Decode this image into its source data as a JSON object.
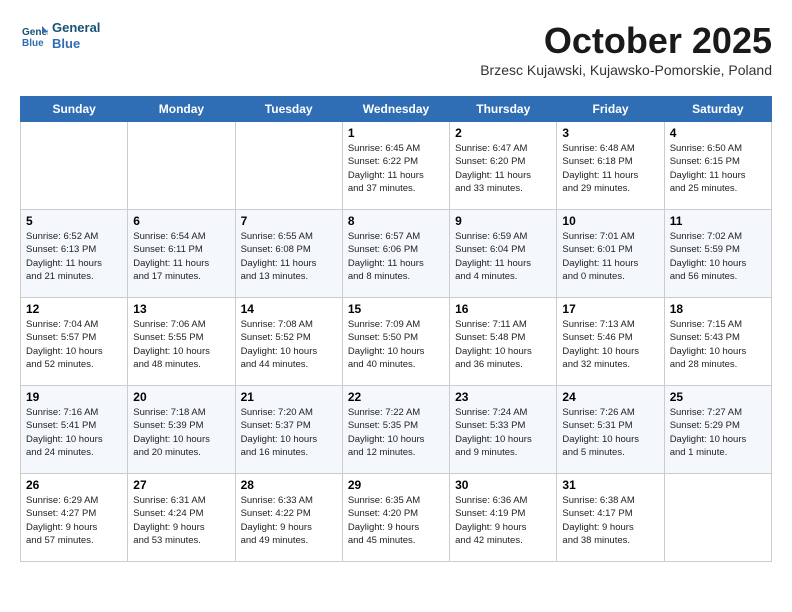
{
  "header": {
    "logo_line1": "General",
    "logo_line2": "Blue",
    "month_title": "October 2025",
    "subtitle": "Brzesc Kujawski, Kujawsko-Pomorskie, Poland"
  },
  "days_of_week": [
    "Sunday",
    "Monday",
    "Tuesday",
    "Wednesday",
    "Thursday",
    "Friday",
    "Saturday"
  ],
  "weeks": [
    [
      {
        "day": "",
        "info": ""
      },
      {
        "day": "",
        "info": ""
      },
      {
        "day": "",
        "info": ""
      },
      {
        "day": "1",
        "info": "Sunrise: 6:45 AM\nSunset: 6:22 PM\nDaylight: 11 hours\nand 37 minutes."
      },
      {
        "day": "2",
        "info": "Sunrise: 6:47 AM\nSunset: 6:20 PM\nDaylight: 11 hours\nand 33 minutes."
      },
      {
        "day": "3",
        "info": "Sunrise: 6:48 AM\nSunset: 6:18 PM\nDaylight: 11 hours\nand 29 minutes."
      },
      {
        "day": "4",
        "info": "Sunrise: 6:50 AM\nSunset: 6:15 PM\nDaylight: 11 hours\nand 25 minutes."
      }
    ],
    [
      {
        "day": "5",
        "info": "Sunrise: 6:52 AM\nSunset: 6:13 PM\nDaylight: 11 hours\nand 21 minutes."
      },
      {
        "day": "6",
        "info": "Sunrise: 6:54 AM\nSunset: 6:11 PM\nDaylight: 11 hours\nand 17 minutes."
      },
      {
        "day": "7",
        "info": "Sunrise: 6:55 AM\nSunset: 6:08 PM\nDaylight: 11 hours\nand 13 minutes."
      },
      {
        "day": "8",
        "info": "Sunrise: 6:57 AM\nSunset: 6:06 PM\nDaylight: 11 hours\nand 8 minutes."
      },
      {
        "day": "9",
        "info": "Sunrise: 6:59 AM\nSunset: 6:04 PM\nDaylight: 11 hours\nand 4 minutes."
      },
      {
        "day": "10",
        "info": "Sunrise: 7:01 AM\nSunset: 6:01 PM\nDaylight: 11 hours\nand 0 minutes."
      },
      {
        "day": "11",
        "info": "Sunrise: 7:02 AM\nSunset: 5:59 PM\nDaylight: 10 hours\nand 56 minutes."
      }
    ],
    [
      {
        "day": "12",
        "info": "Sunrise: 7:04 AM\nSunset: 5:57 PM\nDaylight: 10 hours\nand 52 minutes."
      },
      {
        "day": "13",
        "info": "Sunrise: 7:06 AM\nSunset: 5:55 PM\nDaylight: 10 hours\nand 48 minutes."
      },
      {
        "day": "14",
        "info": "Sunrise: 7:08 AM\nSunset: 5:52 PM\nDaylight: 10 hours\nand 44 minutes."
      },
      {
        "day": "15",
        "info": "Sunrise: 7:09 AM\nSunset: 5:50 PM\nDaylight: 10 hours\nand 40 minutes."
      },
      {
        "day": "16",
        "info": "Sunrise: 7:11 AM\nSunset: 5:48 PM\nDaylight: 10 hours\nand 36 minutes."
      },
      {
        "day": "17",
        "info": "Sunrise: 7:13 AM\nSunset: 5:46 PM\nDaylight: 10 hours\nand 32 minutes."
      },
      {
        "day": "18",
        "info": "Sunrise: 7:15 AM\nSunset: 5:43 PM\nDaylight: 10 hours\nand 28 minutes."
      }
    ],
    [
      {
        "day": "19",
        "info": "Sunrise: 7:16 AM\nSunset: 5:41 PM\nDaylight: 10 hours\nand 24 minutes."
      },
      {
        "day": "20",
        "info": "Sunrise: 7:18 AM\nSunset: 5:39 PM\nDaylight: 10 hours\nand 20 minutes."
      },
      {
        "day": "21",
        "info": "Sunrise: 7:20 AM\nSunset: 5:37 PM\nDaylight: 10 hours\nand 16 minutes."
      },
      {
        "day": "22",
        "info": "Sunrise: 7:22 AM\nSunset: 5:35 PM\nDaylight: 10 hours\nand 12 minutes."
      },
      {
        "day": "23",
        "info": "Sunrise: 7:24 AM\nSunset: 5:33 PM\nDaylight: 10 hours\nand 9 minutes."
      },
      {
        "day": "24",
        "info": "Sunrise: 7:26 AM\nSunset: 5:31 PM\nDaylight: 10 hours\nand 5 minutes."
      },
      {
        "day": "25",
        "info": "Sunrise: 7:27 AM\nSunset: 5:29 PM\nDaylight: 10 hours\nand 1 minute."
      }
    ],
    [
      {
        "day": "26",
        "info": "Sunrise: 6:29 AM\nSunset: 4:27 PM\nDaylight: 9 hours\nand 57 minutes."
      },
      {
        "day": "27",
        "info": "Sunrise: 6:31 AM\nSunset: 4:24 PM\nDaylight: 9 hours\nand 53 minutes."
      },
      {
        "day": "28",
        "info": "Sunrise: 6:33 AM\nSunset: 4:22 PM\nDaylight: 9 hours\nand 49 minutes."
      },
      {
        "day": "29",
        "info": "Sunrise: 6:35 AM\nSunset: 4:20 PM\nDaylight: 9 hours\nand 45 minutes."
      },
      {
        "day": "30",
        "info": "Sunrise: 6:36 AM\nSunset: 4:19 PM\nDaylight: 9 hours\nand 42 minutes."
      },
      {
        "day": "31",
        "info": "Sunrise: 6:38 AM\nSunset: 4:17 PM\nDaylight: 9 hours\nand 38 minutes."
      },
      {
        "day": "",
        "info": ""
      }
    ]
  ]
}
